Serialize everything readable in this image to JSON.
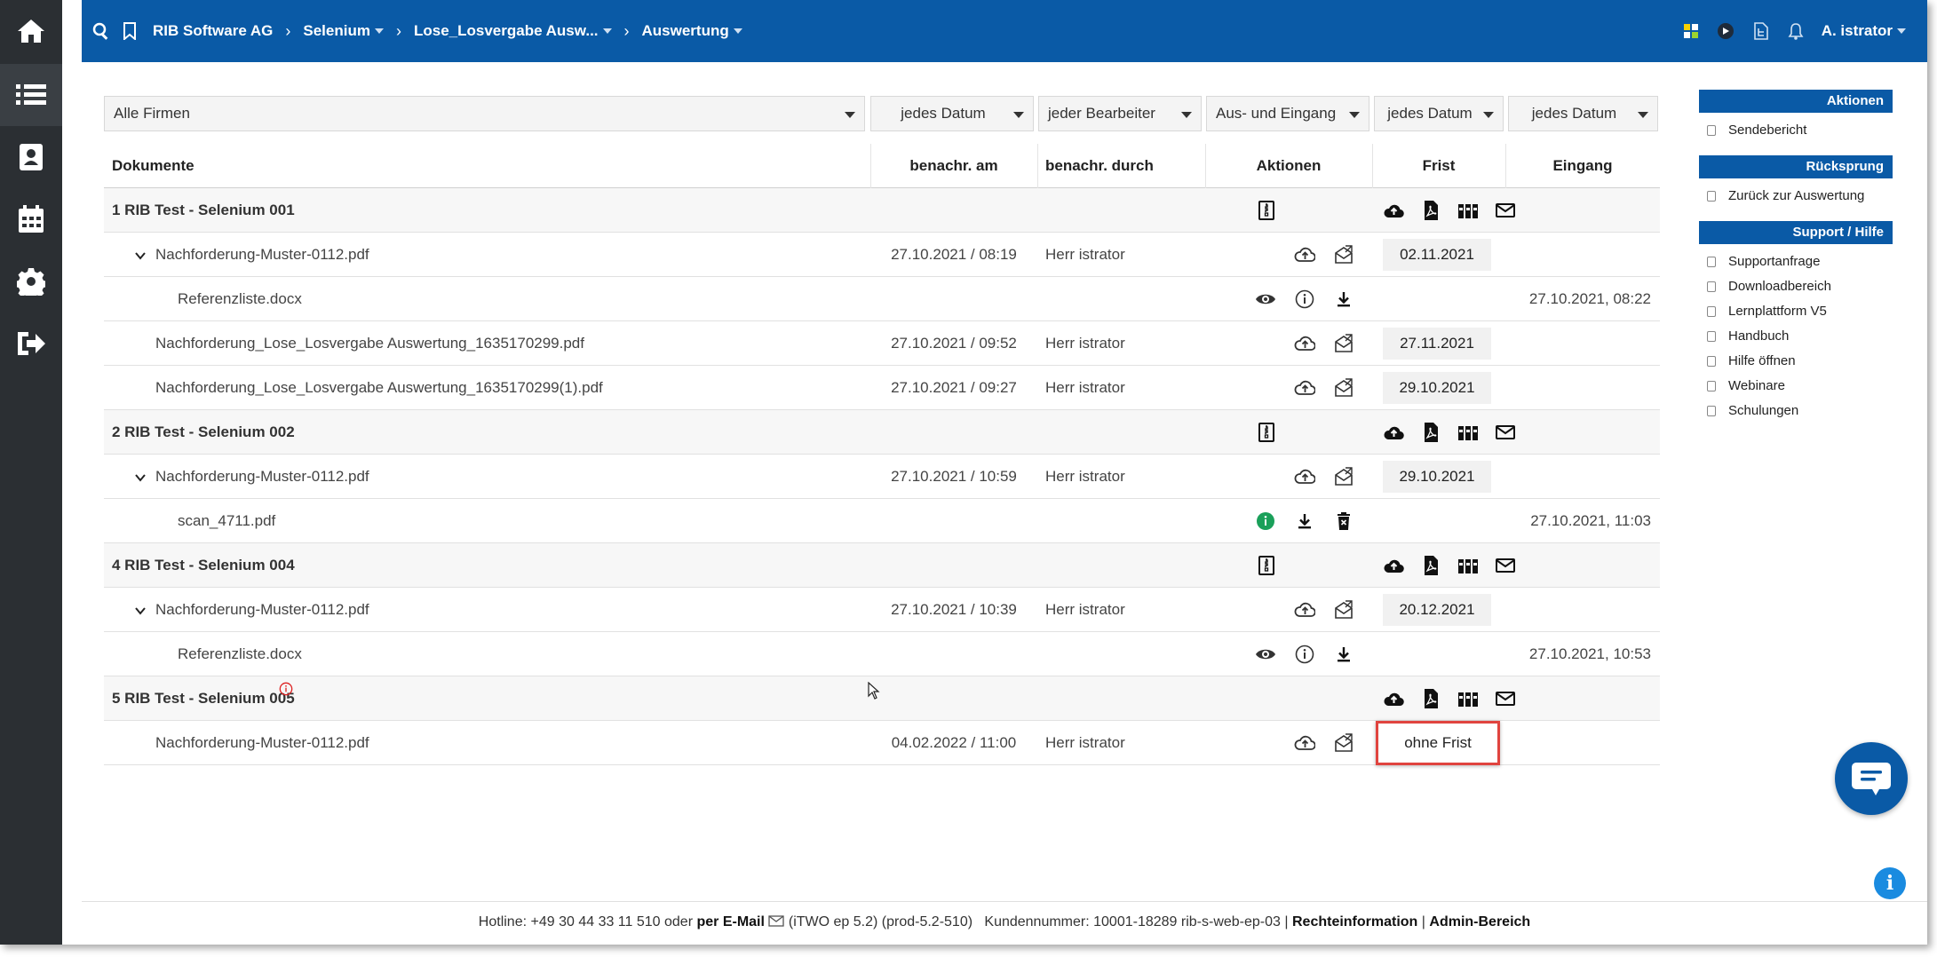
{
  "breadcrumb": {
    "items": [
      {
        "label": "RIB Software AG",
        "dropdown": false
      },
      {
        "label": "Selenium",
        "dropdown": true
      },
      {
        "label": "Lose_Losvergabe Ausw...",
        "dropdown": true
      },
      {
        "label": "Auswertung",
        "dropdown": true
      }
    ]
  },
  "user": {
    "label": "A. istrator"
  },
  "filters": {
    "firm": "Alle Firmen",
    "date1": "jedes Datum",
    "editor": "jeder Bearbeiter",
    "direction": "Aus- und Eingang",
    "date2": "jedes Datum",
    "date3": "jedes Datum"
  },
  "table": {
    "headers": {
      "documents": "Dokumente",
      "notified_at": "benachr. am",
      "notified_by": "benachr. durch",
      "actions": "Aktionen",
      "deadline": "Frist",
      "receipt": "Eingang"
    },
    "rows": [
      {
        "kind": "group",
        "title": "1 RIB Test - Selenium 001",
        "marker": false
      },
      {
        "kind": "doc",
        "expand": true,
        "indent": 1,
        "name": "Nachforderung-Muster-0112.pdf",
        "date": "27.10.2021 / 08:19",
        "by": "Herr istrator",
        "frist": "02.11.2021",
        "eingang": ""
      },
      {
        "kind": "file",
        "indent": 2,
        "name": "Referenzliste.docx",
        "actions": [
          "eye",
          "info",
          "download"
        ],
        "eingang": "27.10.2021, 08:22"
      },
      {
        "kind": "doc",
        "expand": false,
        "indent": 1,
        "name": "Nachforderung_Lose_Losvergabe Auswertung_1635170299.pdf",
        "date": "27.10.2021 / 09:52",
        "by": "Herr istrator",
        "frist": "27.11.2021",
        "eingang": ""
      },
      {
        "kind": "doc",
        "expand": false,
        "indent": 1,
        "name": "Nachforderung_Lose_Losvergabe Auswertung_1635170299(1).pdf",
        "date": "27.10.2021 / 09:27",
        "by": "Herr istrator",
        "frist": "29.10.2021",
        "eingang": ""
      },
      {
        "kind": "group",
        "title": "2 RIB Test - Selenium 002",
        "marker": false
      },
      {
        "kind": "doc",
        "expand": true,
        "indent": 1,
        "name": "Nachforderung-Muster-0112.pdf",
        "date": "27.10.2021 / 10:59",
        "by": "Herr istrator",
        "frist": "29.10.2021",
        "eingang": ""
      },
      {
        "kind": "file",
        "indent": 2,
        "name": "scan_4711.pdf",
        "actions": [
          "info-green",
          "download",
          "delete"
        ],
        "eingang": "27.10.2021, 11:03"
      },
      {
        "kind": "group",
        "title": "4 RIB Test - Selenium 004",
        "marker": false
      },
      {
        "kind": "doc",
        "expand": true,
        "indent": 1,
        "name": "Nachforderung-Muster-0112.pdf",
        "date": "27.10.2021 / 10:39",
        "by": "Herr istrator",
        "frist": "20.12.2021",
        "eingang": ""
      },
      {
        "kind": "file",
        "indent": 2,
        "name": "Referenzliste.docx",
        "actions": [
          "eye",
          "info",
          "download"
        ],
        "eingang": "27.10.2021, 10:53"
      },
      {
        "kind": "group",
        "title": "5 RIB Test - Selenium 005",
        "marker": true,
        "no_archive": true
      },
      {
        "kind": "doc",
        "expand": false,
        "indent": 1,
        "name": "Nachforderung-Muster-0112.pdf",
        "date": "04.02.2022 / 11:00",
        "by": "Herr istrator",
        "frist": "ohne Frist",
        "highlight": true,
        "eingang": ""
      }
    ]
  },
  "panel": {
    "sections": [
      {
        "title": "Aktionen",
        "items": [
          "Sendebericht"
        ]
      },
      {
        "title": "Rücksprung",
        "items": [
          "Zurück zur Auswertung"
        ]
      },
      {
        "title": "Support / Hilfe",
        "items": [
          "Supportanfrage",
          "Downloadbereich",
          "Lernplattform V5",
          "Handbuch",
          "Hilfe öffnen",
          "Webinare",
          "Schulungen"
        ]
      }
    ]
  },
  "footer": {
    "hotline": "Hotline: +49 30 44 33 11 510 oder",
    "email": "per E-Mail",
    "version": "(iTWO ep 5.2) (prod-5.2-510)",
    "customer": "Kundennummer: 10001-18289 rib-s-web-ep-03 |",
    "legal": "Rechteinformation",
    "divider": "|",
    "admin": "Admin-Bereich"
  },
  "colors": {
    "brand": "#0a5aa6",
    "rail": "#2b2f33",
    "highlight": "#e0443f",
    "ok": "#1aa05a"
  },
  "icons": [
    "home-icon",
    "list-icon",
    "contacts-icon",
    "calendar-icon",
    "settings-icon",
    "logout-icon",
    "search-icon",
    "bookmark-icon",
    "upload-icon",
    "pdf-icon",
    "archive-icon",
    "mail-icon",
    "send-mail-icon",
    "zip-icon",
    "eye-icon",
    "info-icon",
    "download-icon",
    "delete-icon",
    "bell-icon",
    "chat-icon"
  ]
}
